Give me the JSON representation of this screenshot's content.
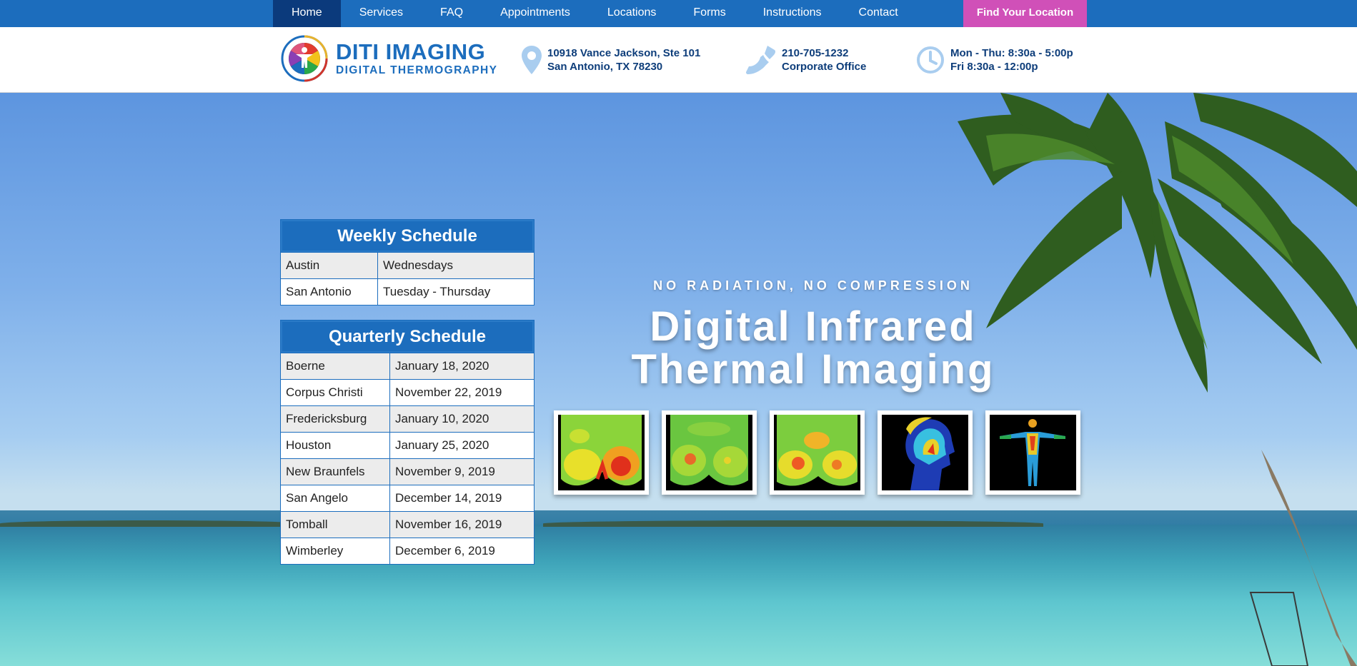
{
  "nav": {
    "items": [
      {
        "label": "Home"
      },
      {
        "label": "Services"
      },
      {
        "label": "FAQ"
      },
      {
        "label": "Appointments"
      },
      {
        "label": "Locations"
      },
      {
        "label": "Forms"
      },
      {
        "label": "Instructions"
      },
      {
        "label": "Contact"
      }
    ],
    "active": "Home",
    "cta": "Find Your Location"
  },
  "header": {
    "logo": {
      "title": "DITI IMAGING",
      "subtitle": "DIGITAL THERMOGRAPHY"
    },
    "address": {
      "line1": "10918 Vance Jackson, Ste 101",
      "line2": "San Antonio, TX 78230",
      "icon": "map-pin-icon"
    },
    "phone": {
      "line1": "210-705-1232",
      "line2": "Corporate Office",
      "icon": "phone-icon"
    },
    "hours": {
      "line1": "Mon - Thu: 8:30a - 5:00p",
      "line2": "Fri 8:30a - 12:00p",
      "icon": "clock-icon"
    }
  },
  "weekly": {
    "title": "Weekly Schedule",
    "rows": [
      [
        "Austin",
        "Wednesdays"
      ],
      [
        "San Antonio",
        "Tuesday - Thursday"
      ]
    ]
  },
  "quarterly": {
    "title": "Quarterly Schedule",
    "rows": [
      [
        "Boerne",
        "January 18, 2020"
      ],
      [
        "Corpus Christi",
        "November 22, 2019"
      ],
      [
        "Fredericksburg",
        "January 10, 2020"
      ],
      [
        "Houston",
        "January 25, 2020"
      ],
      [
        "New Braunfels",
        "November 9, 2019"
      ],
      [
        "San Angelo",
        "December 14, 2019"
      ],
      [
        "Tomball",
        "November 16, 2019"
      ],
      [
        "Wimberley",
        "December 6, 2019"
      ]
    ]
  },
  "hero": {
    "kicker": "NO RADIATION, NO COMPRESSION",
    "headline_line1": "Digital Infrared",
    "headline_line2": "Thermal Imaging"
  },
  "colors": {
    "brand": "#1c6dbd",
    "nav_active": "#0b3a7c",
    "cta": "#d050b8",
    "info_text": "#0d3d7a"
  }
}
